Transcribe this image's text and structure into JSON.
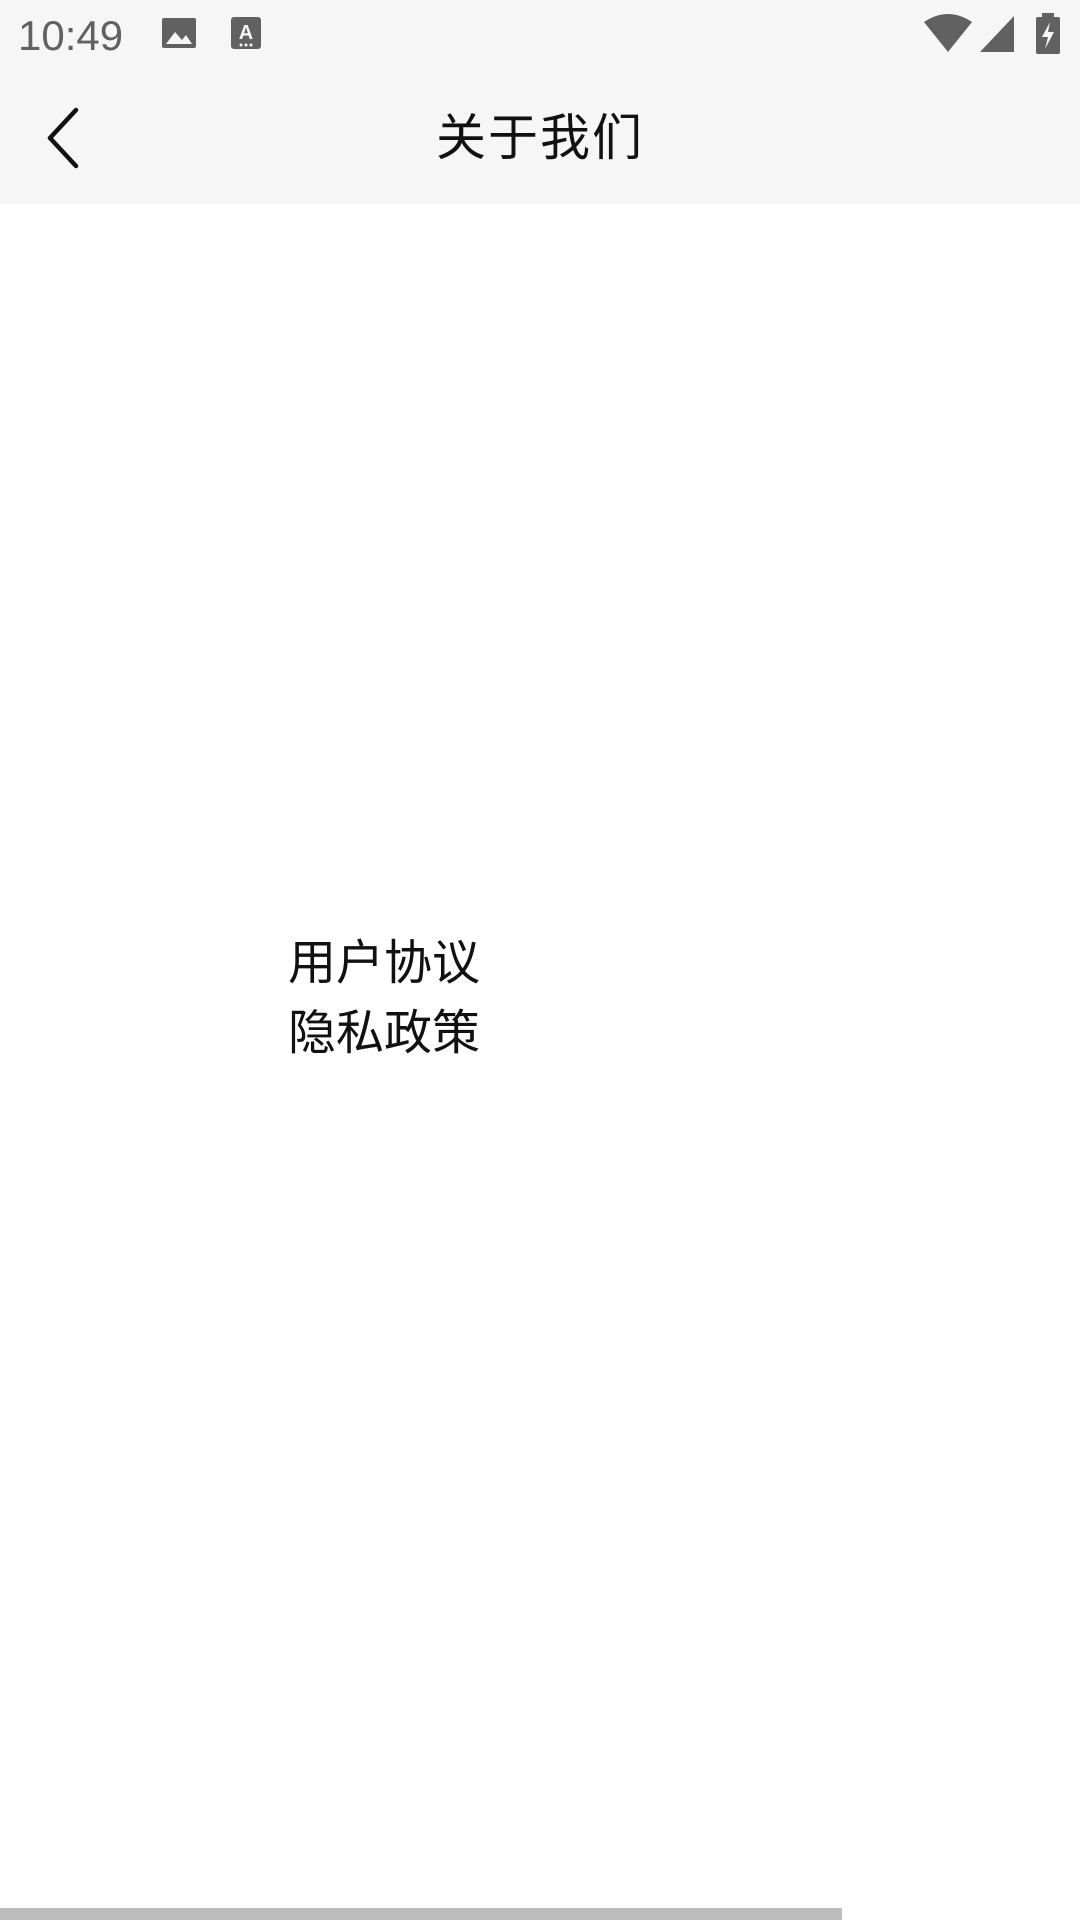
{
  "status_bar": {
    "time": "10:49",
    "left_icons": [
      "image-icon",
      "text-a-icon"
    ],
    "right_icons": [
      "wifi-icon",
      "cellular-signal-icon",
      "battery-charging-icon"
    ],
    "icon_color": "#616161",
    "background": "#f6f6f6"
  },
  "app_bar": {
    "back_icon": "chevron-left-icon",
    "title": "关于我们",
    "background": "#f6f6f6"
  },
  "links": {
    "user_agreement": "用户协议",
    "privacy_policy": "隐私政策"
  },
  "colors": {
    "text": "#111111",
    "scroll_indicator": "#bdbdbd"
  }
}
